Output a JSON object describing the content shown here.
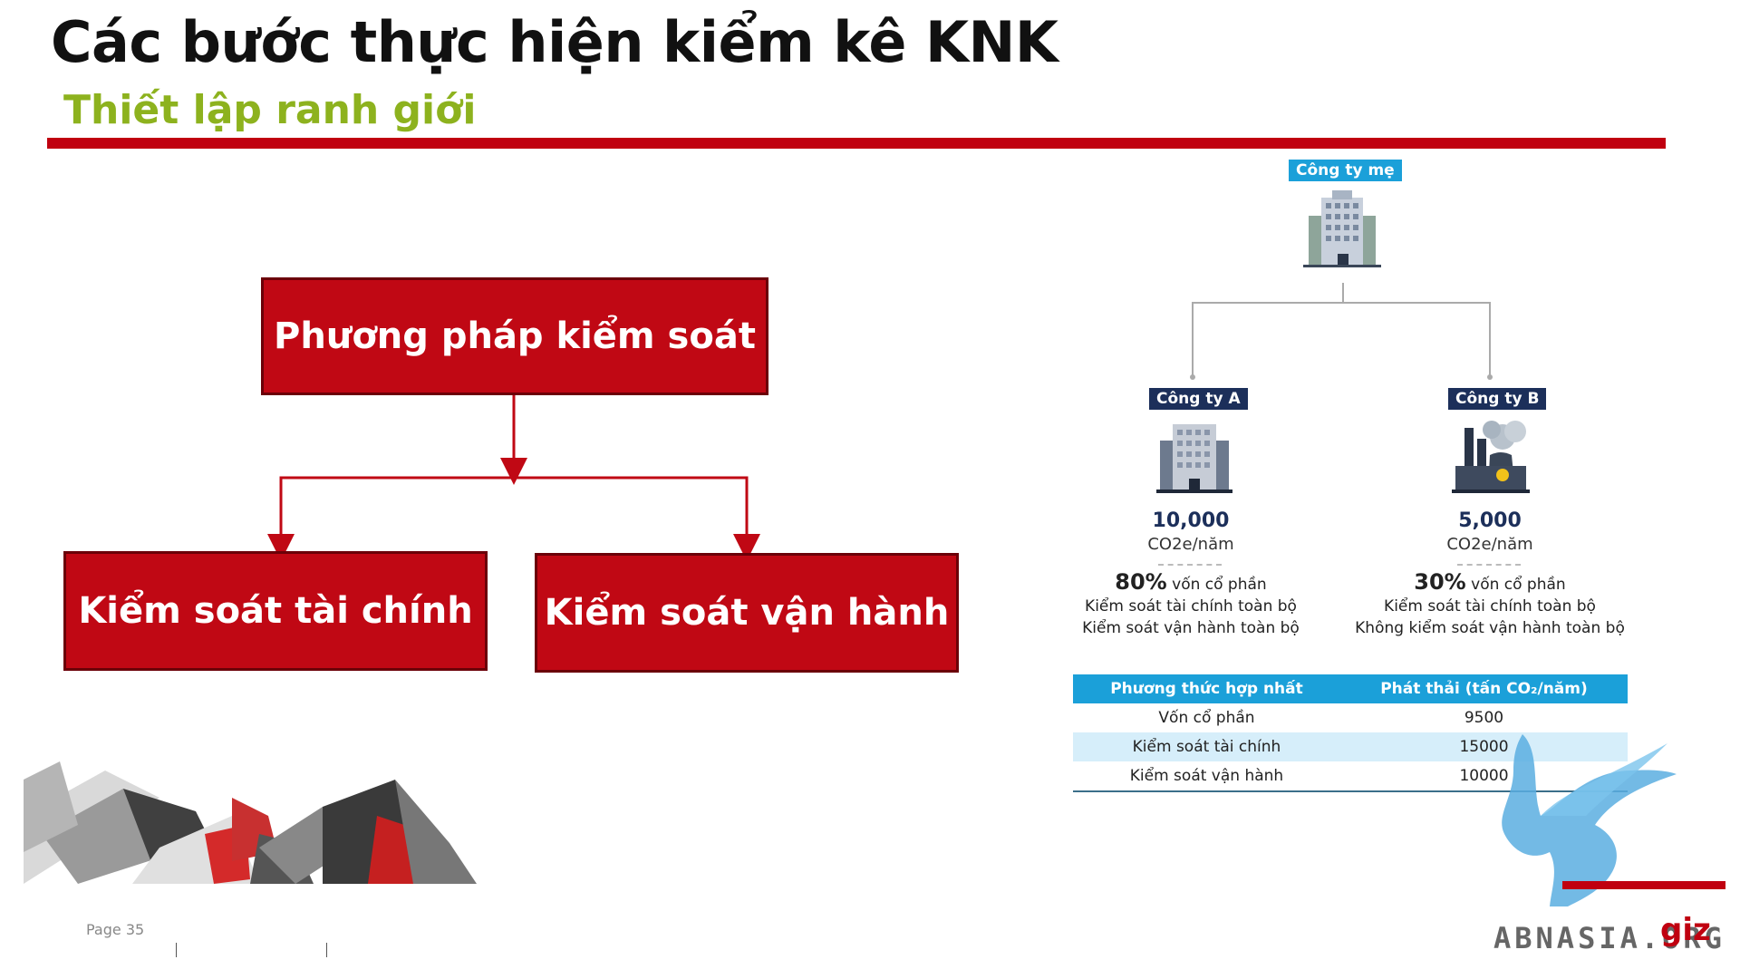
{
  "header": {
    "title": "Các bước thực hiện kiểm kê KNK",
    "subtitle": "Thiết lập ranh giới"
  },
  "diagram": {
    "root": "Phương pháp kiểm soát",
    "left": "Kiểm soát tài chính",
    "right": "Kiểm soát vận hành"
  },
  "org": {
    "parent": "Công ty mẹ",
    "company_a": {
      "label": "Công ty A",
      "emission": "10,000",
      "unit": "CO2e/năm",
      "equity_pct": "80%",
      "equity_text": "vốn cổ phần",
      "line1": "Kiểm soát tài chính toàn bộ",
      "line2": "Kiểm soát vận hành toàn bộ"
    },
    "company_b": {
      "label": "Công ty B",
      "emission": "5,000",
      "unit": "CO2e/năm",
      "equity_pct": "30%",
      "equity_text": "vốn cổ phần",
      "line1": "Kiểm soát tài chính toàn bộ",
      "line2": "Không kiểm soát vận hành toàn bộ"
    }
  },
  "table": {
    "headers": [
      "Phương thức hợp nhất",
      "Phát thải (tấn CO₂/năm)"
    ],
    "rows": [
      [
        "Vốn cổ phần",
        "9500"
      ],
      [
        "Kiểm soát tài chính",
        "15000"
      ],
      [
        "Kiểm soát vận hành",
        "10000"
      ]
    ]
  },
  "footer": {
    "page": "Page 35",
    "watermark": "ABNASIA.ORG",
    "logo": "giz"
  },
  "colors": {
    "red": "#c00814",
    "green": "#8db21e",
    "navy": "#1c2f5a",
    "blue": "#1ba0d9"
  }
}
